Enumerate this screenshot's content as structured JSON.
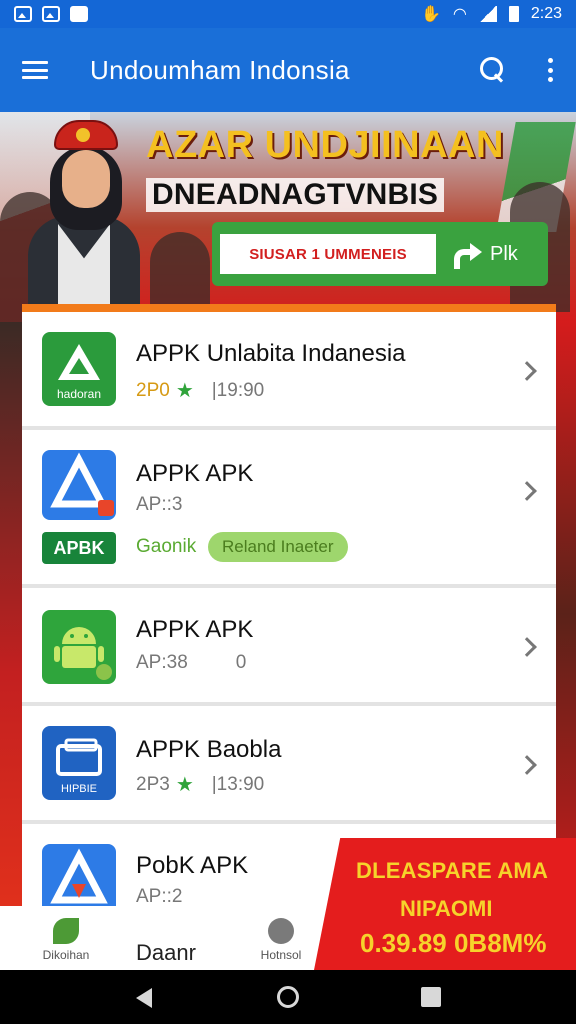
{
  "status_bar": {
    "time": "2:23"
  },
  "app_bar": {
    "title": "Undoumham Indonsia"
  },
  "hero": {
    "title_line1": "AZAR UNDJIINAAN",
    "title_line2": "DNEADNAGTVNBIS",
    "button_label": "SIUSAR 1 UMMENEIS",
    "button_action": "Plk"
  },
  "apps": [
    {
      "icon": "letter-a-icon",
      "icon_text": "hadoran",
      "title": "APPK Unlabita Indanesia",
      "rating": "2P0",
      "size": "|19:90"
    },
    {
      "icon": "store-a-icon",
      "icon_text": "",
      "title": "APPK APK",
      "meta": "AP::3",
      "badge": "APBK",
      "category": "Gaonik",
      "tag": "Reland Inaeter"
    },
    {
      "icon": "android-icon",
      "icon_text": "",
      "title": "APPK APK",
      "meta": "AP:38",
      "extra": "0"
    },
    {
      "icon": "folder-icon",
      "icon_text": "HIPBIE",
      "title": "APPK Baobla",
      "rating": "2P3",
      "size": "|13:90"
    },
    {
      "icon": "store-a-icon",
      "icon_text": "",
      "title": "PobK APK",
      "meta": "AP::2"
    }
  ],
  "bottom_nav": {
    "left_label": "Dikoihan",
    "center_label": "Daanr",
    "right_label": "Hotnsol"
  },
  "promo_corner": {
    "line1": "DLEASPARE AMA",
    "line2": "NIPAOMI",
    "line3": "0.39.89 0B8M%"
  },
  "colors": {
    "primary": "#1a6fd8",
    "green": "#2b9b3c",
    "red": "#e41d1d",
    "orange": "#f27b1a"
  }
}
